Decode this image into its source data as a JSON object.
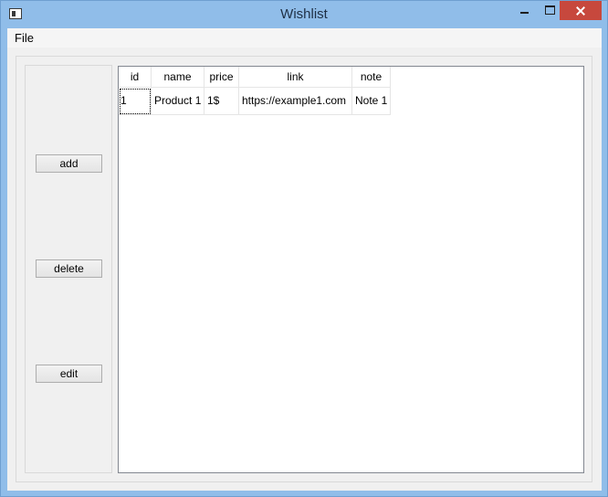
{
  "window": {
    "title": "Wishlist"
  },
  "menu": {
    "file": "File"
  },
  "buttons": {
    "add": "add",
    "delete": "delete",
    "edit": "edit"
  },
  "table": {
    "columns": [
      "id",
      "name",
      "price",
      "link",
      "note"
    ],
    "rows": [
      [
        "1",
        "Product 1",
        "1$",
        "https://example1.com",
        "Note 1"
      ]
    ]
  }
}
